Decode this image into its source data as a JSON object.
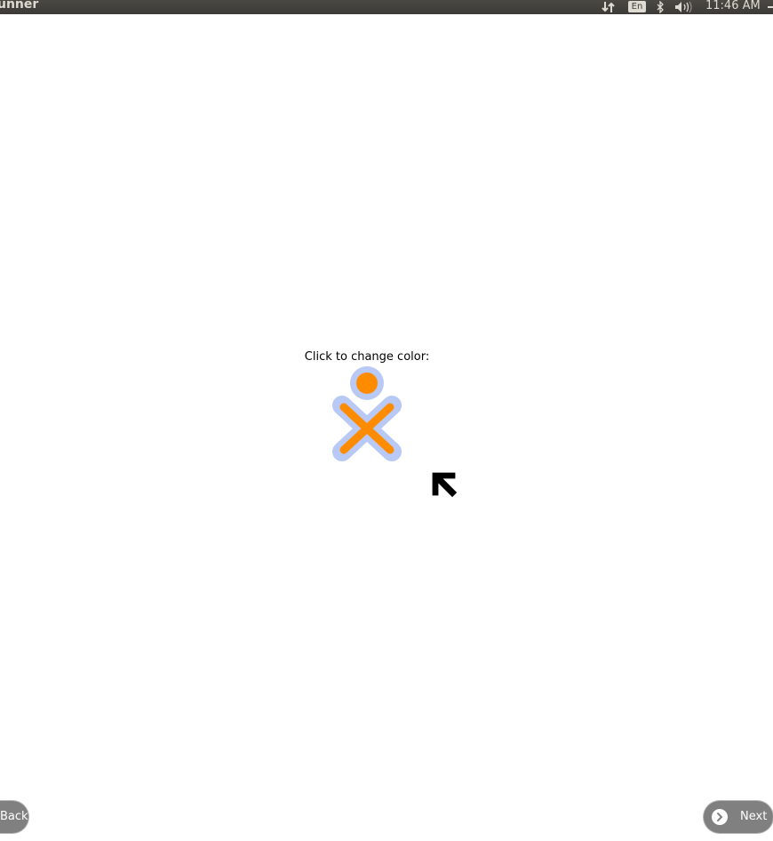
{
  "topbar": {
    "app_title": "unner",
    "keyboard_layout": "En",
    "clock": "11:46 AM",
    "icons": [
      "network-icon",
      "keyboard-layout-icon",
      "bluetooth-icon",
      "volume-icon",
      "session-gear-icon"
    ]
  },
  "main": {
    "prompt": "Click to change color:",
    "xo_icon": {
      "fill_color": "#ff8c00",
      "stroke_color": "#b9c9f5"
    }
  },
  "nav": {
    "back_label": "Back",
    "next_label": "Next"
  },
  "colors": {
    "topbar_bg": "#3c3b37",
    "button_bg": "#808080"
  }
}
